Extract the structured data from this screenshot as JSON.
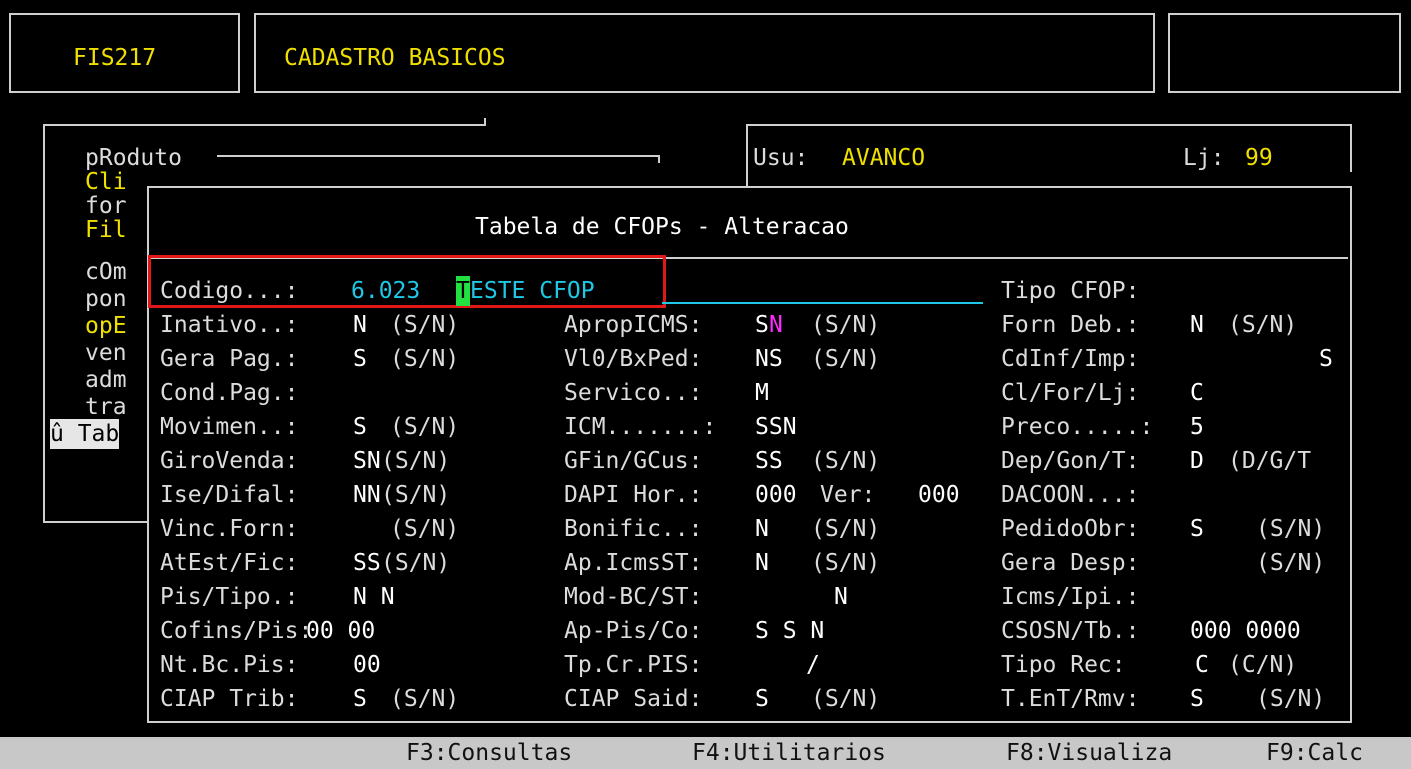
{
  "header": {
    "program_code": "FIS217",
    "title": "CADASTRO BASICOS"
  },
  "menu": {
    "items": [
      "pRoduto",
      "Cli",
      "for",
      "Fil",
      "cOm",
      "pon",
      "opE",
      "ven",
      "adm",
      "tra"
    ],
    "selected": "û Tab"
  },
  "user_panel": {
    "user_label": "Usu:",
    "user_value": "AVANCO",
    "store_label": "Lj:",
    "store_value": "99"
  },
  "form": {
    "title": "Tabela de CFOPs - Alteracao",
    "codigo_label": "Codigo...:",
    "codigo_value": "6.023",
    "description_first_char": "T",
    "description_rest": "ESTE CFOP",
    "col1": [
      {
        "label": "Inativo..:",
        "value": "N",
        "hint": "(S/N)"
      },
      {
        "label": "Gera Pag.:",
        "value": "S",
        "hint": "(S/N)"
      },
      {
        "label": "Cond.Pag.:",
        "value": "",
        "hint": ""
      },
      {
        "label": "Movimen..:",
        "value": "S",
        "hint": "(S/N)"
      },
      {
        "label": "GiroVenda:",
        "value": "SN",
        "hint": "(S/N)"
      },
      {
        "label": "Ise/Difal:",
        "value": "NN",
        "hint": "(S/N)"
      },
      {
        "label": "Vinc.Forn:",
        "value": "",
        "hint": "(S/N)"
      },
      {
        "label": "AtEst/Fic:",
        "value": "SS",
        "hint": "(S/N)"
      },
      {
        "label": "Pis/Tipo.:",
        "value": "N N",
        "hint": ""
      },
      {
        "label": "Cofins/Pis:",
        "value": "00 00",
        "hint": ""
      },
      {
        "label": "Nt.Bc.Pis:",
        "value": "00",
        "hint": ""
      },
      {
        "label": "CIAP Trib:",
        "value": "S",
        "hint": "(S/N)"
      }
    ],
    "col2": [
      {
        "label": "ApropICMS:",
        "value_a": "S",
        "value_b": "N",
        "hint": "(S/N)"
      },
      {
        "label": "Vl0/BxPed:",
        "value": "NS",
        "hint": "(S/N)"
      },
      {
        "label": "Servico..:",
        "value": "M",
        "hint": ""
      },
      {
        "label": "ICM.......:",
        "value": "SSN",
        "hint": ""
      },
      {
        "label": "GFin/GCus:",
        "value": "SS",
        "hint": "(S/N)"
      },
      {
        "label": "DAPI Hor.:",
        "value": "000",
        "extra_label": "Ver:",
        "extra_value": "000"
      },
      {
        "label": "Bonific..:",
        "value": "N",
        "hint": "(S/N)"
      },
      {
        "label": "Ap.IcmsST:",
        "value": "N",
        "hint": "(S/N)"
      },
      {
        "label": "Mod-BC/ST:",
        "value": "N",
        "hint": ""
      },
      {
        "label": "Ap-Pis/Co:",
        "value": "S S N",
        "hint": ""
      },
      {
        "label": "Tp.Cr.PIS:",
        "value": "/",
        "hint": ""
      },
      {
        "label": "CIAP Said:",
        "value": "S",
        "hint": "(S/N)"
      }
    ],
    "col3": [
      {
        "label": "Tipo CFOP:",
        "value": "",
        "hint": ""
      },
      {
        "label": "Forn Deb.:",
        "value": "N",
        "hint": "(S/N)"
      },
      {
        "label": "CdInf/Imp:",
        "value": "S",
        "hint": ""
      },
      {
        "label": "Cl/For/Lj:",
        "value": "C",
        "hint": ""
      },
      {
        "label": "Preco.....:",
        "value": "5",
        "hint": ""
      },
      {
        "label": "Dep/Gon/T:",
        "value": "D",
        "hint": "(D/G/T"
      },
      {
        "label": "DACOON...:",
        "value": "",
        "hint": ""
      },
      {
        "label": "PedidoObr:",
        "value": "S",
        "hint": "(S/N)"
      },
      {
        "label": "Gera Desp:",
        "value": "",
        "hint": "(S/N)"
      },
      {
        "label": "Icms/Ipi.:",
        "value": "",
        "hint": ""
      },
      {
        "label": "CSOSN/Tb.:",
        "value": "000 0000",
        "hint": ""
      },
      {
        "label": "Tipo Rec:",
        "value": "C",
        "hint": "(C/N)"
      },
      {
        "label": "T.EnT/Rmv:",
        "value": "S",
        "hint": "(S/N)"
      }
    ]
  },
  "statusbar": {
    "f3": "F3:Consultas",
    "f4": "F4:Utilitarios",
    "f8": "F8:Visualiza",
    "f9": "F9:Calc"
  }
}
